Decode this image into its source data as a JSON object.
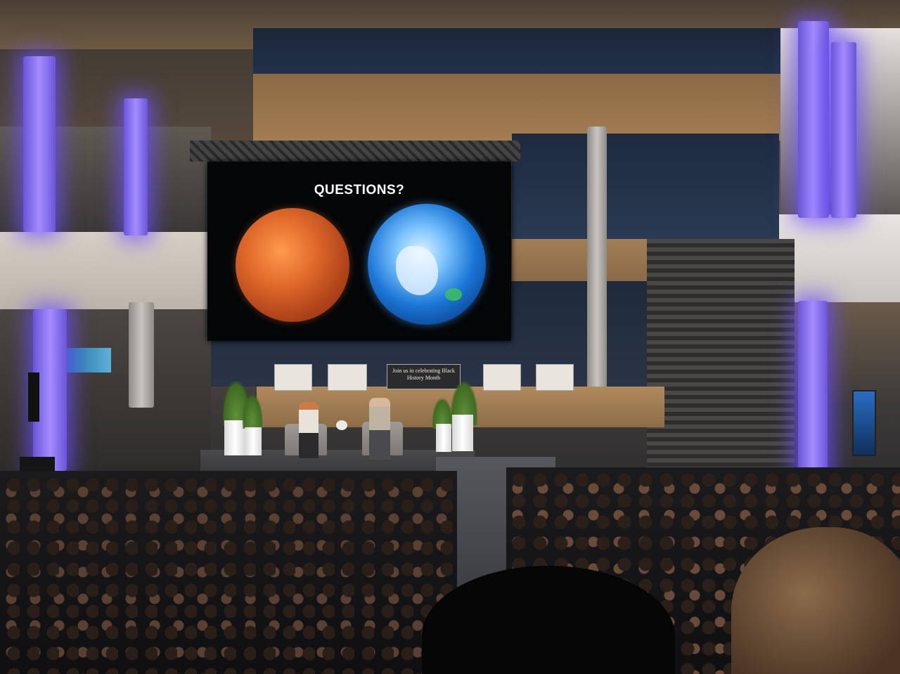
{
  "scene": {
    "screen": {
      "title": "QUESTIONS?"
    },
    "banner": {
      "text": "Join us in celebrating Black History Month"
    },
    "colors": {
      "pillar_glow": "#7a5cff",
      "mars": "#d65a22",
      "earth": "#1b76d6",
      "stage": "#3a3a3c",
      "wood": "#a27c52"
    },
    "icons": [
      "mars-planet-image",
      "earth-planet-image"
    ]
  }
}
